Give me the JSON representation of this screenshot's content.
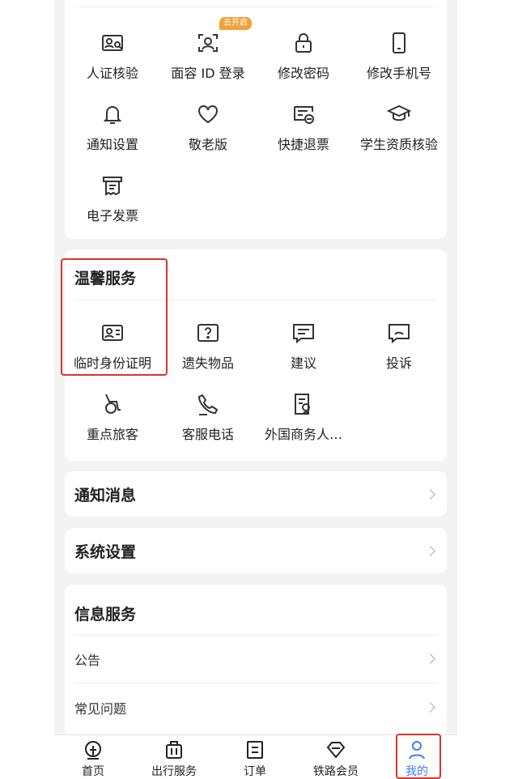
{
  "account": {
    "items": [
      {
        "label": "人证核验",
        "icon": "id-verify-icon"
      },
      {
        "label": "面容 ID 登录",
        "icon": "face-id-icon",
        "badge": "去开启"
      },
      {
        "label": "修改密码",
        "icon": "lock-icon"
      },
      {
        "label": "修改手机号",
        "icon": "phone-icon"
      },
      {
        "label": "通知设置",
        "icon": "bell-icon"
      },
      {
        "label": "敬老版",
        "icon": "heart-icon"
      },
      {
        "label": "快捷退票",
        "icon": "ticket-refund-icon"
      },
      {
        "label": "学生资质核验",
        "icon": "graduation-cap-icon"
      },
      {
        "label": "电子发票",
        "icon": "invoice-icon"
      }
    ]
  },
  "warm_service": {
    "title": "温馨服务",
    "items": [
      {
        "label": "临时身份证明",
        "icon": "id-card-icon"
      },
      {
        "label": "遗失物品",
        "icon": "question-box-icon"
      },
      {
        "label": "建议",
        "icon": "suggestion-icon"
      },
      {
        "label": "投诉",
        "icon": "complaint-icon"
      },
      {
        "label": "重点旅客",
        "icon": "wheelchair-icon"
      },
      {
        "label": "客服电话",
        "icon": "phone-call-icon"
      },
      {
        "label": "外国商务人…",
        "icon": "foreign-business-icon"
      }
    ]
  },
  "rows": {
    "notifications": "通知消息",
    "settings": "系统设置"
  },
  "info_service": {
    "title": "信息服务",
    "items": [
      {
        "label": "公告"
      },
      {
        "label": "常见问题"
      }
    ]
  },
  "tabbar": {
    "items": [
      {
        "label": "首页",
        "icon": "home-icon"
      },
      {
        "label": "出行服务",
        "icon": "luggage-icon"
      },
      {
        "label": "订单",
        "icon": "order-icon"
      },
      {
        "label": "铁路会员",
        "icon": "diamond-icon"
      },
      {
        "label": "我的",
        "icon": "user-icon"
      }
    ],
    "active_color": "#3b7ff0"
  },
  "colors": {
    "badge": "#f3a13c",
    "highlight": "#d9342b"
  }
}
